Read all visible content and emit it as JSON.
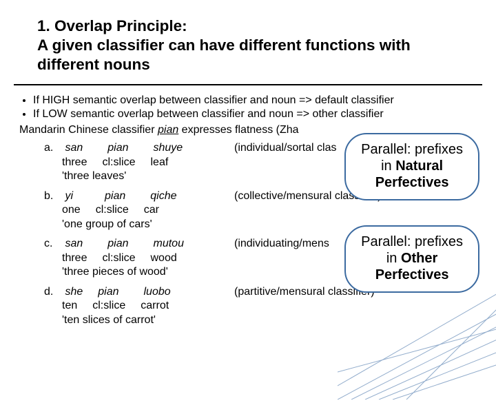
{
  "title": {
    "line1": "1. Overlap Principle:",
    "line2": "A given classifier can have different functions with different nouns"
  },
  "bullets": [
    "If HIGH semantic overlap between classifier and noun => default classifier",
    "If LOW semantic overlap between classifier and noun => other classifier"
  ],
  "intro": {
    "prefix": "Mandarin Chinese classifier ",
    "term": "pian",
    "rest": " expresses flatness (Zha"
  },
  "examples": [
    {
      "label": "a.",
      "words": [
        "san",
        "pian",
        "shuye"
      ],
      "gloss": [
        "three",
        "cl:slice",
        "leaf"
      ],
      "trans": "'three leaves'",
      "note": "(individual/sortal clas"
    },
    {
      "label": "b.",
      "words": [
        "yi",
        "pian",
        "qiche"
      ],
      "gloss": [
        "one",
        "cl:slice",
        "car"
      ],
      "trans": "'one group of cars'",
      "note": "(collective/mensural classifier)"
    },
    {
      "label": "c.",
      "words": [
        "san",
        "pian",
        "mutou"
      ],
      "gloss": [
        "three",
        "cl:slice",
        "wood"
      ],
      "trans": "'three pieces of wood'",
      "note": "(individuating/mens"
    },
    {
      "label": "d.",
      "words": [
        "she",
        "pian",
        "luobo"
      ],
      "gloss": [
        "ten",
        "cl:slice",
        "carrot"
      ],
      "trans": "'ten slices of carrot'",
      "note": "(partitive/mensural classifier)"
    }
  ],
  "bubbles": {
    "b1": {
      "line1": "Parallel: prefixes",
      "line2a": "in ",
      "line2b": "Natural",
      "line3": "Perfectives"
    },
    "b2": {
      "line1": "Parallel: prefixes",
      "line2a": "in ",
      "line2b": "Other",
      "line3": "Perfectives"
    }
  }
}
